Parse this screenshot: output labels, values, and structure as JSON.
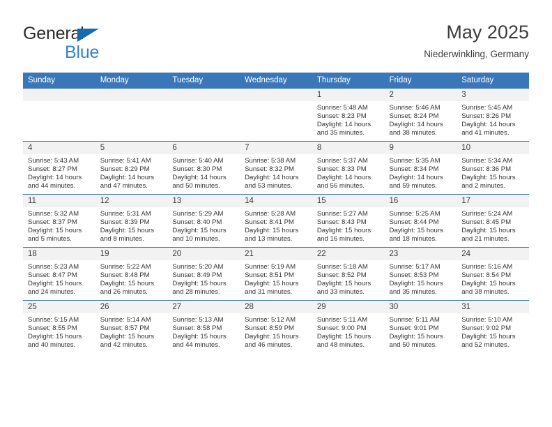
{
  "brand": {
    "name_part1": "General",
    "name_part2": "Blue",
    "triangle_color": "#1769b0",
    "accent_color": "#2f85d0"
  },
  "header": {
    "title": "May 2025",
    "subtitle": "Niederwinkling, Germany"
  },
  "theme": {
    "header_blue": "#3a77b8",
    "daynum_band": "#f2f2f2",
    "text": "#333333"
  },
  "weekday_headers": [
    "Sunday",
    "Monday",
    "Tuesday",
    "Wednesday",
    "Thursday",
    "Friday",
    "Saturday"
  ],
  "labels": {
    "sunrise_prefix": "Sunrise:",
    "sunset_prefix": "Sunset:",
    "daylight_prefix": "Daylight:"
  },
  "weeks": [
    [
      {
        "day": "",
        "empty": true,
        "line1": "",
        "line2": "",
        "line3": "",
        "line4": ""
      },
      {
        "day": "",
        "empty": true,
        "line1": "",
        "line2": "",
        "line3": "",
        "line4": ""
      },
      {
        "day": "",
        "empty": true,
        "line1": "",
        "line2": "",
        "line3": "",
        "line4": ""
      },
      {
        "day": "",
        "empty": true,
        "line1": "",
        "line2": "",
        "line3": "",
        "line4": ""
      },
      {
        "day": "1",
        "empty": false,
        "line1": "Sunrise: 5:48 AM",
        "line2": "Sunset: 8:23 PM",
        "line3": "Daylight: 14 hours",
        "line4": "and 35 minutes."
      },
      {
        "day": "2",
        "empty": false,
        "line1": "Sunrise: 5:46 AM",
        "line2": "Sunset: 8:24 PM",
        "line3": "Daylight: 14 hours",
        "line4": "and 38 minutes."
      },
      {
        "day": "3",
        "empty": false,
        "line1": "Sunrise: 5:45 AM",
        "line2": "Sunset: 8:26 PM",
        "line3": "Daylight: 14 hours",
        "line4": "and 41 minutes."
      }
    ],
    [
      {
        "day": "4",
        "empty": false,
        "line1": "Sunrise: 5:43 AM",
        "line2": "Sunset: 8:27 PM",
        "line3": "Daylight: 14 hours",
        "line4": "and 44 minutes."
      },
      {
        "day": "5",
        "empty": false,
        "line1": "Sunrise: 5:41 AM",
        "line2": "Sunset: 8:29 PM",
        "line3": "Daylight: 14 hours",
        "line4": "and 47 minutes."
      },
      {
        "day": "6",
        "empty": false,
        "line1": "Sunrise: 5:40 AM",
        "line2": "Sunset: 8:30 PM",
        "line3": "Daylight: 14 hours",
        "line4": "and 50 minutes."
      },
      {
        "day": "7",
        "empty": false,
        "line1": "Sunrise: 5:38 AM",
        "line2": "Sunset: 8:32 PM",
        "line3": "Daylight: 14 hours",
        "line4": "and 53 minutes."
      },
      {
        "day": "8",
        "empty": false,
        "line1": "Sunrise: 5:37 AM",
        "line2": "Sunset: 8:33 PM",
        "line3": "Daylight: 14 hours",
        "line4": "and 56 minutes."
      },
      {
        "day": "9",
        "empty": false,
        "line1": "Sunrise: 5:35 AM",
        "line2": "Sunset: 8:34 PM",
        "line3": "Daylight: 14 hours",
        "line4": "and 59 minutes."
      },
      {
        "day": "10",
        "empty": false,
        "line1": "Sunrise: 5:34 AM",
        "line2": "Sunset: 8:36 PM",
        "line3": "Daylight: 15 hours",
        "line4": "and 2 minutes."
      }
    ],
    [
      {
        "day": "11",
        "empty": false,
        "line1": "Sunrise: 5:32 AM",
        "line2": "Sunset: 8:37 PM",
        "line3": "Daylight: 15 hours",
        "line4": "and 5 minutes."
      },
      {
        "day": "12",
        "empty": false,
        "line1": "Sunrise: 5:31 AM",
        "line2": "Sunset: 8:39 PM",
        "line3": "Daylight: 15 hours",
        "line4": "and 8 minutes."
      },
      {
        "day": "13",
        "empty": false,
        "line1": "Sunrise: 5:29 AM",
        "line2": "Sunset: 8:40 PM",
        "line3": "Daylight: 15 hours",
        "line4": "and 10 minutes."
      },
      {
        "day": "14",
        "empty": false,
        "line1": "Sunrise: 5:28 AM",
        "line2": "Sunset: 8:41 PM",
        "line3": "Daylight: 15 hours",
        "line4": "and 13 minutes."
      },
      {
        "day": "15",
        "empty": false,
        "line1": "Sunrise: 5:27 AM",
        "line2": "Sunset: 8:43 PM",
        "line3": "Daylight: 15 hours",
        "line4": "and 16 minutes."
      },
      {
        "day": "16",
        "empty": false,
        "line1": "Sunrise: 5:25 AM",
        "line2": "Sunset: 8:44 PM",
        "line3": "Daylight: 15 hours",
        "line4": "and 18 minutes."
      },
      {
        "day": "17",
        "empty": false,
        "line1": "Sunrise: 5:24 AM",
        "line2": "Sunset: 8:45 PM",
        "line3": "Daylight: 15 hours",
        "line4": "and 21 minutes."
      }
    ],
    [
      {
        "day": "18",
        "empty": false,
        "line1": "Sunrise: 5:23 AM",
        "line2": "Sunset: 8:47 PM",
        "line3": "Daylight: 15 hours",
        "line4": "and 24 minutes."
      },
      {
        "day": "19",
        "empty": false,
        "line1": "Sunrise: 5:22 AM",
        "line2": "Sunset: 8:48 PM",
        "line3": "Daylight: 15 hours",
        "line4": "and 26 minutes."
      },
      {
        "day": "20",
        "empty": false,
        "line1": "Sunrise: 5:20 AM",
        "line2": "Sunset: 8:49 PM",
        "line3": "Daylight: 15 hours",
        "line4": "and 28 minutes."
      },
      {
        "day": "21",
        "empty": false,
        "line1": "Sunrise: 5:19 AM",
        "line2": "Sunset: 8:51 PM",
        "line3": "Daylight: 15 hours",
        "line4": "and 31 minutes."
      },
      {
        "day": "22",
        "empty": false,
        "line1": "Sunrise: 5:18 AM",
        "line2": "Sunset: 8:52 PM",
        "line3": "Daylight: 15 hours",
        "line4": "and 33 minutes."
      },
      {
        "day": "23",
        "empty": false,
        "line1": "Sunrise: 5:17 AM",
        "line2": "Sunset: 8:53 PM",
        "line3": "Daylight: 15 hours",
        "line4": "and 35 minutes."
      },
      {
        "day": "24",
        "empty": false,
        "line1": "Sunrise: 5:16 AM",
        "line2": "Sunset: 8:54 PM",
        "line3": "Daylight: 15 hours",
        "line4": "and 38 minutes."
      }
    ],
    [
      {
        "day": "25",
        "empty": false,
        "line1": "Sunrise: 5:15 AM",
        "line2": "Sunset: 8:55 PM",
        "line3": "Daylight: 15 hours",
        "line4": "and 40 minutes."
      },
      {
        "day": "26",
        "empty": false,
        "line1": "Sunrise: 5:14 AM",
        "line2": "Sunset: 8:57 PM",
        "line3": "Daylight: 15 hours",
        "line4": "and 42 minutes."
      },
      {
        "day": "27",
        "empty": false,
        "line1": "Sunrise: 5:13 AM",
        "line2": "Sunset: 8:58 PM",
        "line3": "Daylight: 15 hours",
        "line4": "and 44 minutes."
      },
      {
        "day": "28",
        "empty": false,
        "line1": "Sunrise: 5:12 AM",
        "line2": "Sunset: 8:59 PM",
        "line3": "Daylight: 15 hours",
        "line4": "and 46 minutes."
      },
      {
        "day": "29",
        "empty": false,
        "line1": "Sunrise: 5:11 AM",
        "line2": "Sunset: 9:00 PM",
        "line3": "Daylight: 15 hours",
        "line4": "and 48 minutes."
      },
      {
        "day": "30",
        "empty": false,
        "line1": "Sunrise: 5:11 AM",
        "line2": "Sunset: 9:01 PM",
        "line3": "Daylight: 15 hours",
        "line4": "and 50 minutes."
      },
      {
        "day": "31",
        "empty": false,
        "line1": "Sunrise: 5:10 AM",
        "line2": "Sunset: 9:02 PM",
        "line3": "Daylight: 15 hours",
        "line4": "and 52 minutes."
      }
    ]
  ]
}
